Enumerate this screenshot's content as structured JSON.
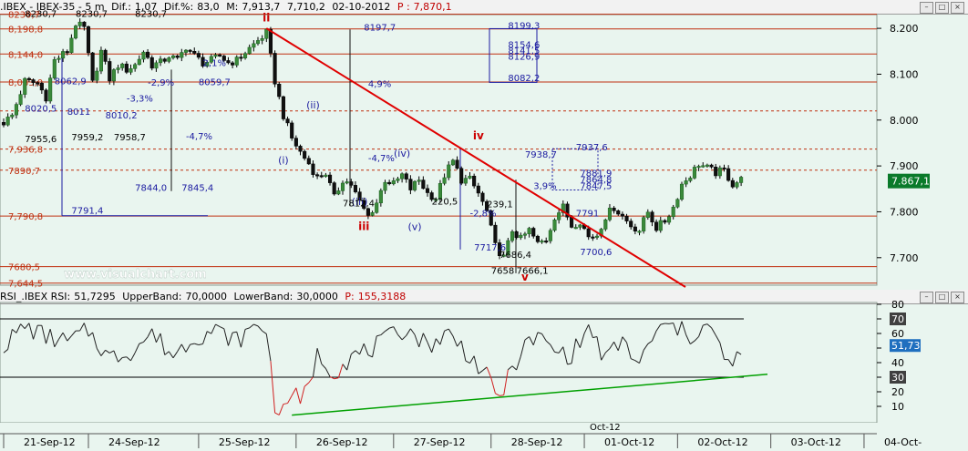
{
  "header": {
    "symbol": ".IBEX - IBEX-35 - 5 m",
    "dif_label": "Dif.:",
    "dif": "1,07",
    "difp_label": "Dif.%:",
    "difp": "83,0",
    "m_label": "M:",
    "m": "7,913,7",
    "low": "7,710,2",
    "date": "02-10-2012",
    "p_label": "P :",
    "p": "7,870,1"
  },
  "rsi_header": {
    "name": "RSI_.IBEX RSI:",
    "value": "51,7295",
    "upper_label": "UpperBand:",
    "upper": "70,0000",
    "lower_label": "LowerBand:",
    "lower": "30,0000",
    "p_label": "P:",
    "p": "155,3188"
  },
  "watermark": "www.visualchart.com",
  "window_buttons": [
    "–",
    "□",
    "×"
  ],
  "colors": {
    "up": "#2d7d3a",
    "down": "#c00000",
    "trend": "#e00000",
    "support": "#00a000",
    "wave": "#2020a0",
    "level": "#c03010",
    "panel_bg": "#e9f5ef"
  },
  "chart_data": [
    {
      "type": "candlestick",
      "title": "IBEX-35 5 m",
      "ylim": [
        7640,
        8230
      ],
      "y_ticks": [
        "8.200",
        "8.100",
        "8.000",
        "7.900",
        "7.800",
        "7.700"
      ],
      "y_tick_values": [
        8200,
        8100,
        8000,
        7900,
        7800,
        7700
      ],
      "last_price_label": "7.867,1",
      "last_price": 7867.1,
      "x_ticks": [
        "21-Sep-12",
        "24-Sep-12",
        "25-Sep-12",
        "26-Sep-12",
        "27-Sep-12",
        "28-Sep-12",
        "01-Oct-12",
        "02-Oct-12",
        "03-Oct-12",
        "04-Oct-"
      ],
      "x_sub_label": "Oct-12",
      "anchors": [
        [
          0,
          7995
        ],
        [
          2,
          8010
        ],
        [
          5,
          8085
        ],
        [
          8,
          8080
        ],
        [
          10,
          8050
        ],
        [
          12,
          8130
        ],
        [
          15,
          8150
        ],
        [
          17,
          8210
        ],
        [
          19,
          8200
        ],
        [
          21,
          8080
        ],
        [
          23,
          8150
        ],
        [
          25,
          8090
        ],
        [
          27,
          8120
        ],
        [
          29,
          8110
        ],
        [
          31,
          8120
        ],
        [
          33,
          8150
        ],
        [
          35,
          8120
        ],
        [
          37,
          8125
        ],
        [
          39,
          8140
        ],
        [
          41,
          8130
        ],
        [
          43,
          8160
        ],
        [
          45,
          8140
        ],
        [
          47,
          8125
        ],
        [
          49,
          8130
        ],
        [
          51,
          8140
        ],
        [
          53,
          8125
        ],
        [
          55,
          8130
        ],
        [
          57,
          8148
        ],
        [
          59,
          8165
        ],
        [
          62,
          8190
        ],
        [
          64,
          8085
        ],
        [
          66,
          8010
        ],
        [
          68,
          7960
        ],
        [
          70,
          7930
        ],
        [
          72,
          7905
        ],
        [
          74,
          7875
        ],
        [
          76,
          7885
        ],
        [
          78,
          7830
        ],
        [
          80,
          7870
        ],
        [
          82,
          7860
        ],
        [
          84,
          7820
        ],
        [
          86,
          7790
        ],
        [
          88,
          7820
        ],
        [
          90,
          7870
        ],
        [
          92,
          7860
        ],
        [
          94,
          7880
        ],
        [
          96,
          7850
        ],
        [
          98,
          7870
        ],
        [
          100,
          7840
        ],
        [
          102,
          7830
        ],
        [
          104,
          7880
        ],
        [
          106,
          7910
        ],
        [
          108,
          7870
        ],
        [
          110,
          7870
        ],
        [
          112,
          7840
        ],
        [
          114,
          7800
        ],
        [
          116,
          7725
        ],
        [
          118,
          7700
        ],
        [
          120,
          7760
        ],
        [
          122,
          7740
        ],
        [
          124,
          7760
        ],
        [
          126,
          7730
        ],
        [
          128,
          7740
        ],
        [
          130,
          7790
        ],
        [
          132,
          7810
        ],
        [
          134,
          7770
        ],
        [
          136,
          7780
        ],
        [
          138,
          7745
        ],
        [
          140,
          7750
        ],
        [
          142,
          7790
        ],
        [
          144,
          7810
        ],
        [
          146,
          7790
        ],
        [
          148,
          7770
        ],
        [
          150,
          7760
        ],
        [
          152,
          7800
        ],
        [
          154,
          7765
        ],
        [
          156,
          7780
        ],
        [
          158,
          7810
        ],
        [
          160,
          7860
        ],
        [
          162,
          7880
        ],
        [
          164,
          7905
        ],
        [
          166,
          7895
        ],
        [
          168,
          7885
        ],
        [
          170,
          7890
        ],
        [
          172,
          7860
        ],
        [
          174,
          7870
        ]
      ],
      "levels": [
        {
          "value": 8230.7,
          "label": "8230,7"
        },
        {
          "value": 8198.8,
          "label": "8,198,8"
        },
        {
          "value": 8144.0,
          "label": "8,144,0"
        },
        {
          "value": 8083.0,
          "label": "8,083,0"
        },
        {
          "value": 8020.0,
          "label": ""
        },
        {
          "value": 7936.8,
          "label": "7,936,8"
        },
        {
          "value": 7890.7,
          "label": "7890,7"
        },
        {
          "value": 7790.8,
          "label": "7,790,8"
        },
        {
          "value": 7680.5,
          "label": "7680,5"
        },
        {
          "value": 7644.5,
          "label": "7,644,5"
        }
      ],
      "wave_labels": [
        {
          "text": "ii",
          "color": "red",
          "at": [
            62,
            8215
          ]
        },
        {
          "text": "iii",
          "color": "red",
          "at": [
            85,
            7760
          ]
        },
        {
          "text": "iv",
          "color": "red",
          "at": [
            112,
            7958
          ]
        },
        {
          "text": "v",
          "color": "red",
          "at": [
            123,
            7650
          ]
        },
        {
          "text": "(i)",
          "color": "blue",
          "at": [
            66,
            7905
          ]
        },
        {
          "text": "(ii)",
          "color": "blue",
          "at": [
            73,
            8025
          ]
        },
        {
          "text": "(iii)",
          "color": "blue",
          "at": [
            84,
            7815
          ]
        },
        {
          "text": "(iv)",
          "color": "blue",
          "at": [
            94,
            7920
          ]
        },
        {
          "text": "(v)",
          "color": "blue",
          "at": [
            97,
            7760
          ]
        }
      ],
      "annotations": [
        {
          "text": "8230,7",
          "at": [
            5,
            8225
          ]
        },
        {
          "text": "8230,7",
          "at": [
            17,
            8225
          ]
        },
        {
          "text": "8230,7",
          "at": [
            31,
            8225
          ]
        },
        {
          "text": "8197,7",
          "at": [
            85,
            8195
          ]
        },
        {
          "text": "8020,5",
          "at": [
            5,
            8018
          ]
        },
        {
          "text": "8011",
          "at": [
            15,
            8011
          ]
        },
        {
          "text": "8010,2",
          "at": [
            24,
            8004
          ]
        },
        {
          "text": "8062,9",
          "at": [
            12,
            8078
          ]
        },
        {
          "text": "8059,7",
          "at": [
            46,
            8076
          ]
        },
        {
          "text": "7955,6",
          "at": [
            5,
            7952
          ]
        },
        {
          "text": "7959,2",
          "at": [
            16,
            7956
          ]
        },
        {
          "text": "7958,7",
          "at": [
            26,
            7956
          ]
        },
        {
          "text": "7844,0",
          "at": [
            31,
            7846
          ]
        },
        {
          "text": "7845,4",
          "at": [
            42,
            7846
          ]
        },
        {
          "text": "7791,4",
          "at": [
            16,
            7796
          ]
        },
        {
          "text": "7812,4",
          "at": [
            80,
            7812
          ]
        },
        {
          "text": "220,5",
          "at": [
            101,
            7816
          ]
        },
        {
          "text": "239,1",
          "at": [
            114,
            7810
          ]
        },
        {
          "text": "4,9%",
          "at": [
            86,
            8072
          ]
        },
        {
          "text": "-4,7%",
          "at": [
            86,
            7910
          ]
        },
        {
          "text": "-4,7%",
          "at": [
            43,
            7958
          ]
        },
        {
          "text": "2,1%",
          "at": [
            47,
            8118
          ]
        },
        {
          "text": "-2,9%",
          "at": [
            34,
            8075
          ]
        },
        {
          "text": "-3,3%",
          "at": [
            29,
            8040
          ]
        },
        {
          "text": "3,9%",
          "at": [
            125,
            7850
          ]
        },
        {
          "text": "-2,8%",
          "at": [
            110,
            7790
          ]
        },
        {
          "text": "7938,7",
          "at": [
            123,
            7918
          ]
        },
        {
          "text": "7937,6",
          "at": [
            135,
            7934
          ]
        },
        {
          "text": "7881,9",
          "at": [
            136,
            7877
          ]
        },
        {
          "text": "7864,8",
          "at": [
            136,
            7863
          ]
        },
        {
          "text": "7847,5",
          "at": [
            136,
            7850
          ]
        },
        {
          "text": "7791",
          "at": [
            135,
            7790
          ]
        },
        {
          "text": "7717,6",
          "at": [
            111,
            7715
          ]
        },
        {
          "text": "7700,6",
          "at": [
            136,
            7706
          ]
        },
        {
          "text": "7686,4",
          "at": [
            117,
            7700
          ]
        },
        {
          "text": "7658",
          "at": [
            115,
            7665
          ]
        },
        {
          "text": "7666,1",
          "at": [
            121,
            7665
          ]
        },
        {
          "text": "8199,3",
          "at": [
            119,
            8199
          ]
        },
        {
          "text": "8154,6",
          "at": [
            119,
            8157
          ]
        },
        {
          "text": "8141,5",
          "at": [
            119,
            8145
          ]
        },
        {
          "text": "8126,9",
          "at": [
            119,
            8132
          ]
        },
        {
          "text": "8082,2",
          "at": [
            119,
            8085
          ]
        }
      ]
    },
    {
      "type": "line",
      "title": "RSI",
      "ylim": [
        0,
        80
      ],
      "y_ticks": [
        "80",
        "70",
        "60",
        "50",
        "40",
        "30",
        "20",
        "10"
      ],
      "y_tick_values": [
        80,
        70,
        60,
        50,
        40,
        30,
        20,
        10
      ],
      "bands": [
        70,
        30
      ],
      "last_value_label": "51,73",
      "last_value": 51.73,
      "band_labels": [
        "70",
        "30"
      ],
      "anchors": [
        [
          0,
          52
        ],
        [
          5,
          65
        ],
        [
          10,
          58
        ],
        [
          15,
          54
        ],
        [
          20,
          62
        ],
        [
          25,
          43
        ],
        [
          30,
          48
        ],
        [
          35,
          60
        ],
        [
          40,
          45
        ],
        [
          45,
          58
        ],
        [
          50,
          62
        ],
        [
          55,
          55
        ],
        [
          60,
          66
        ],
        [
          62,
          63
        ],
        [
          64,
          12
        ],
        [
          66,
          5
        ],
        [
          68,
          22
        ],
        [
          70,
          10
        ],
        [
          72,
          26
        ],
        [
          74,
          45
        ],
        [
          78,
          34
        ],
        [
          82,
          44
        ],
        [
          86,
          48
        ],
        [
          90,
          55
        ],
        [
          95,
          64
        ],
        [
          100,
          52
        ],
        [
          105,
          60
        ],
        [
          110,
          45
        ],
        [
          114,
          30
        ],
        [
          116,
          17
        ],
        [
          118,
          22
        ],
        [
          122,
          48
        ],
        [
          126,
          58
        ],
        [
          130,
          48
        ],
        [
          134,
          45
        ],
        [
          138,
          64
        ],
        [
          142,
          42
        ],
        [
          146,
          55
        ],
        [
          150,
          38
        ],
        [
          154,
          62
        ],
        [
          158,
          65
        ],
        [
          162,
          58
        ],
        [
          166,
          66
        ],
        [
          170,
          45
        ],
        [
          172,
          34
        ],
        [
          174,
          52
        ]
      ]
    }
  ]
}
